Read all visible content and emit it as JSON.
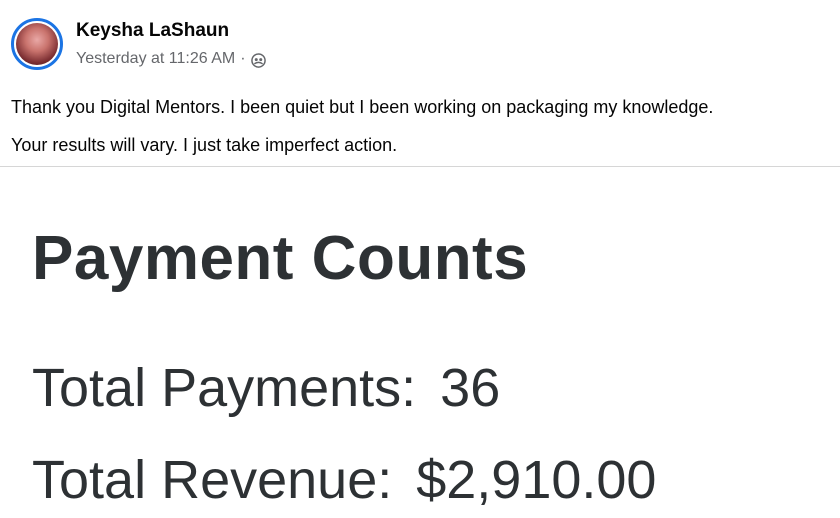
{
  "post": {
    "author": "Keysha LaShaun",
    "timestamp": "Yesterday at 11:26 AM",
    "separator": "·",
    "audience_icon": "friends-icon",
    "text_lines": [
      "Thank you Digital Mentors. I been quiet but I been working on packaging my knowledge.",
      "Your results will vary. I just take imperfect action."
    ]
  },
  "image": {
    "title": "Payment Counts",
    "total_payments_label": "Total Payments:",
    "total_payments_value": "36",
    "total_revenue_label": "Total Revenue:",
    "total_revenue_value": "$2,910.00"
  },
  "colors": {
    "accent": "#1b74e4",
    "meta_text": "#65676b",
    "image_text": "#2d3134"
  }
}
